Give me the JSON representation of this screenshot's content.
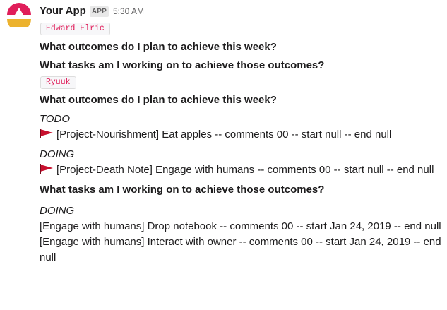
{
  "message": {
    "app_name": "Your App",
    "badge": "APP",
    "time": "5:30 AM"
  },
  "colors": {
    "flag": "#c8102e",
    "code_text": "#e01e5a",
    "avatar_top": "#e01e5a",
    "avatar_bottom": "#ecb22e"
  },
  "blocks": [
    {
      "user": "Edward Elric",
      "q1": "What outcomes do I plan to achieve this week?",
      "q2": "What tasks am I working on to achieve those outcomes?"
    },
    {
      "user": "Ryuuk",
      "q1": "What outcomes do I plan to achieve this week?",
      "outcome_groups": [
        {
          "status": "TODO",
          "item_icon": "red-flag-icon",
          "item": "[Project-Nourishment] Eat apples -- comments 00 -- start null -- end null"
        },
        {
          "status": "DOING",
          "item_icon": "red-flag-icon",
          "item": "[Project-Death Note] Engage with humans -- comments 00 -- start null -- end null"
        }
      ],
      "q2": "What tasks am I working on to achieve those outcomes?",
      "task_group": {
        "status": "DOING",
        "items": [
          "[Engage with humans] Drop notebook -- comments 00 -- start Jan 24, 2019 -- end null",
          "[Engage with humans] Interact with owner -- comments 00 -- start Jan 24, 2019 -- end null"
        ]
      }
    }
  ]
}
